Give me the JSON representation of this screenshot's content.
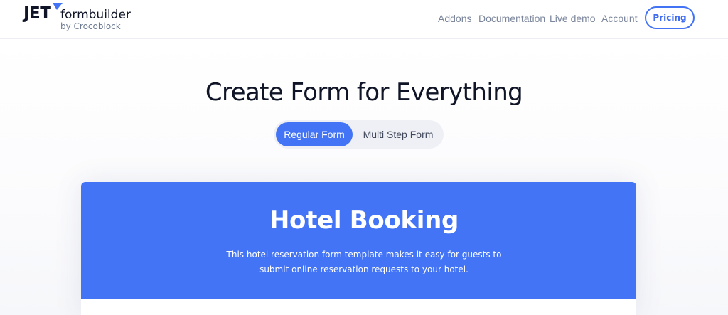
{
  "header": {
    "logo": {
      "jet": "JET",
      "formbuilder": "formbuilder",
      "byline": "by Crocoblock",
      "tick_color": "#4274f5",
      "icon": "logo-mark-icon"
    },
    "nav": {
      "addons": "Addons",
      "documentation": "Documentation",
      "live_demo": "Live demo",
      "account": "Account"
    },
    "pricing_label": "Pricing"
  },
  "hero": {
    "title": "Create Form for Everything",
    "toggle": {
      "regular_label": "Regular Form",
      "multi_label": "Multi Step Form",
      "selected": "Regular Form"
    }
  },
  "card": {
    "title": "Hotel Booking",
    "description_line1": "This hotel reservation form template makes it easy for guests to",
    "description_line2": "submit online reservation requests to your hotel."
  },
  "colors": {
    "accent": "#4274f5",
    "text_dark": "#0f1426",
    "nav_text": "#7b869c"
  }
}
